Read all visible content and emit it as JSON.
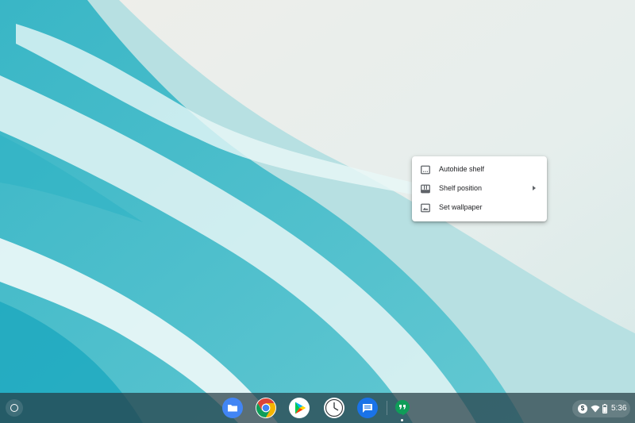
{
  "desktop": {
    "wallpaper": "beach-aerial-wallpaper"
  },
  "context_menu": {
    "items": [
      {
        "label": "Autohide shelf",
        "icon": "autohide-shelf-icon",
        "submenu": false
      },
      {
        "label": "Shelf position",
        "icon": "shelf-position-icon",
        "submenu": true
      },
      {
        "label": "Set wallpaper",
        "icon": "wallpaper-icon",
        "submenu": false
      }
    ]
  },
  "shelf": {
    "launcher_icon": "launcher-circle-icon",
    "apps": [
      {
        "name": "Files",
        "icon": "files-icon",
        "color": "#4285f4"
      },
      {
        "name": "Chrome",
        "icon": "chrome-icon",
        "color": "#db4437"
      },
      {
        "name": "Play Store",
        "icon": "play-store-icon",
        "color": "#00c853"
      },
      {
        "name": "Clock",
        "icon": "clock-icon",
        "color": "#ffffff"
      },
      {
        "name": "Messages",
        "icon": "messages-icon",
        "color": "#1a73e8"
      },
      {
        "name": "Hangouts",
        "icon": "hangouts-icon",
        "color": "#0f9d58"
      }
    ]
  },
  "status_area": {
    "dollar_symbol": "$",
    "wifi_icon": "wifi-icon",
    "battery_icon": "battery-icon",
    "time": "5:36"
  }
}
